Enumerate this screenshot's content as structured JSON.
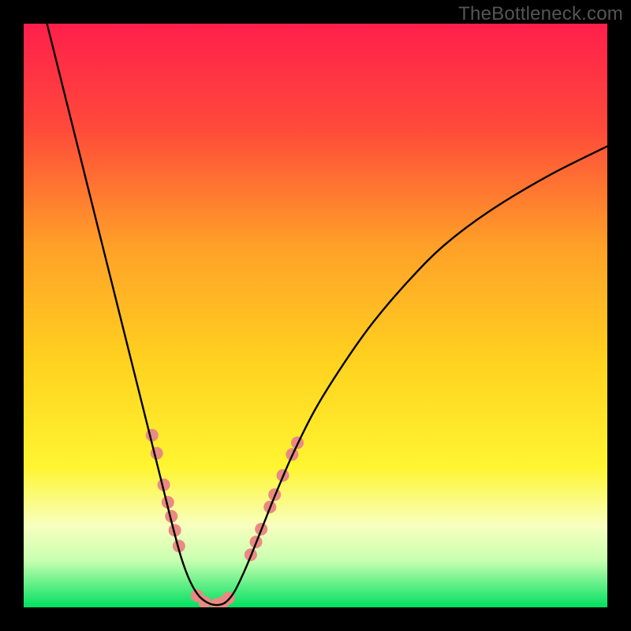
{
  "watermark": "TheBottleneck.com",
  "chart_data": {
    "type": "line",
    "title": "",
    "xlabel": "",
    "ylabel": "",
    "xlim": [
      0,
      100
    ],
    "ylim": [
      0,
      100
    ],
    "gradient_stops": [
      {
        "pct": 0,
        "color": "#ff1f4b"
      },
      {
        "pct": 18,
        "color": "#ff4a3a"
      },
      {
        "pct": 38,
        "color": "#ffa028"
      },
      {
        "pct": 58,
        "color": "#ffd21f"
      },
      {
        "pct": 76,
        "color": "#fff531"
      },
      {
        "pct": 86,
        "color": "#f8ffbf"
      },
      {
        "pct": 92,
        "color": "#c8ffb0"
      },
      {
        "pct": 100,
        "color": "#00e060"
      }
    ],
    "series": [
      {
        "name": "bottleneck-curve",
        "stroke": "#000000",
        "stroke_width": 2.4,
        "points": [
          {
            "x": 4.0,
            "y": 100.0
          },
          {
            "x": 5.0,
            "y": 96.0
          },
          {
            "x": 7.0,
            "y": 88.0
          },
          {
            "x": 9.0,
            "y": 80.0
          },
          {
            "x": 11.0,
            "y": 72.0
          },
          {
            "x": 13.0,
            "y": 64.0
          },
          {
            "x": 15.0,
            "y": 56.0
          },
          {
            "x": 17.0,
            "y": 48.0
          },
          {
            "x": 19.0,
            "y": 40.0
          },
          {
            "x": 21.0,
            "y": 32.0
          },
          {
            "x": 22.5,
            "y": 26.0
          },
          {
            "x": 24.0,
            "y": 20.0
          },
          {
            "x": 25.5,
            "y": 14.0
          },
          {
            "x": 27.0,
            "y": 8.5
          },
          {
            "x": 28.5,
            "y": 4.5
          },
          {
            "x": 30.0,
            "y": 2.0
          },
          {
            "x": 31.5,
            "y": 0.8
          },
          {
            "x": 33.0,
            "y": 0.4
          },
          {
            "x": 34.5,
            "y": 0.8
          },
          {
            "x": 36.0,
            "y": 2.5
          },
          {
            "x": 37.5,
            "y": 5.5
          },
          {
            "x": 39.0,
            "y": 9.0
          },
          {
            "x": 41.0,
            "y": 14.0
          },
          {
            "x": 43.0,
            "y": 19.0
          },
          {
            "x": 46.0,
            "y": 26.0
          },
          {
            "x": 50.0,
            "y": 34.0
          },
          {
            "x": 55.0,
            "y": 42.0
          },
          {
            "x": 60.0,
            "y": 49.0
          },
          {
            "x": 66.0,
            "y": 56.0
          },
          {
            "x": 72.0,
            "y": 62.0
          },
          {
            "x": 80.0,
            "y": 68.0
          },
          {
            "x": 90.0,
            "y": 74.0
          },
          {
            "x": 100.0,
            "y": 79.0
          }
        ]
      }
    ],
    "markers": {
      "color": "#e98a82",
      "radius": 8,
      "points": [
        {
          "x": 22.0,
          "y": 29.5
        },
        {
          "x": 22.8,
          "y": 26.4
        },
        {
          "x": 24.0,
          "y": 21.0
        },
        {
          "x": 24.7,
          "y": 18.0
        },
        {
          "x": 25.3,
          "y": 15.6
        },
        {
          "x": 25.9,
          "y": 13.2
        },
        {
          "x": 26.6,
          "y": 10.5
        },
        {
          "x": 29.7,
          "y": 2.0
        },
        {
          "x": 31.0,
          "y": 0.9
        },
        {
          "x": 33.0,
          "y": 0.5
        },
        {
          "x": 34.2,
          "y": 0.9
        },
        {
          "x": 35.1,
          "y": 1.6
        },
        {
          "x": 38.9,
          "y": 9.0
        },
        {
          "x": 39.8,
          "y": 11.2
        },
        {
          "x": 40.7,
          "y": 13.4
        },
        {
          "x": 42.2,
          "y": 17.2
        },
        {
          "x": 43.0,
          "y": 19.3
        },
        {
          "x": 44.4,
          "y": 22.6
        },
        {
          "x": 46.0,
          "y": 26.2
        },
        {
          "x": 46.9,
          "y": 28.2
        }
      ]
    }
  }
}
